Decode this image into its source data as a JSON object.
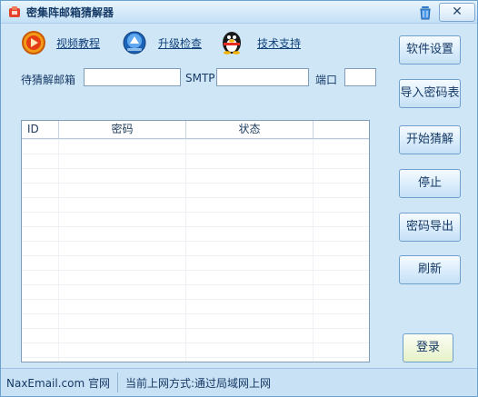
{
  "window": {
    "title": "密集阵邮箱猜解器",
    "close_label": "✕"
  },
  "toolbar": {
    "links": [
      {
        "label": "视频教程",
        "icon": "play-icon"
      },
      {
        "label": "升级检查",
        "icon": "upgrade-icon"
      },
      {
        "label": "技术支持",
        "icon": "qq-penguin-icon"
      }
    ]
  },
  "form": {
    "email_label": "待猜解邮箱",
    "email_value": "",
    "smtp_label": "SMTP",
    "smtp_value": "",
    "port_label": "端口",
    "port_value": ""
  },
  "table": {
    "columns": [
      "ID",
      "密码",
      "状态",
      ""
    ],
    "rows": []
  },
  "buttons": {
    "settings": "软件设置",
    "import": "导入密码表",
    "start": "开始猜解",
    "stop": "停止",
    "export": "密码导出",
    "refresh": "刷新",
    "login": "登录"
  },
  "status": {
    "site": "NaxEmail.com 官网",
    "network": "当前上网方式:通过局域网上网"
  },
  "colors": {
    "window_bg": "#cfe6f7",
    "accent": "#10407a"
  }
}
